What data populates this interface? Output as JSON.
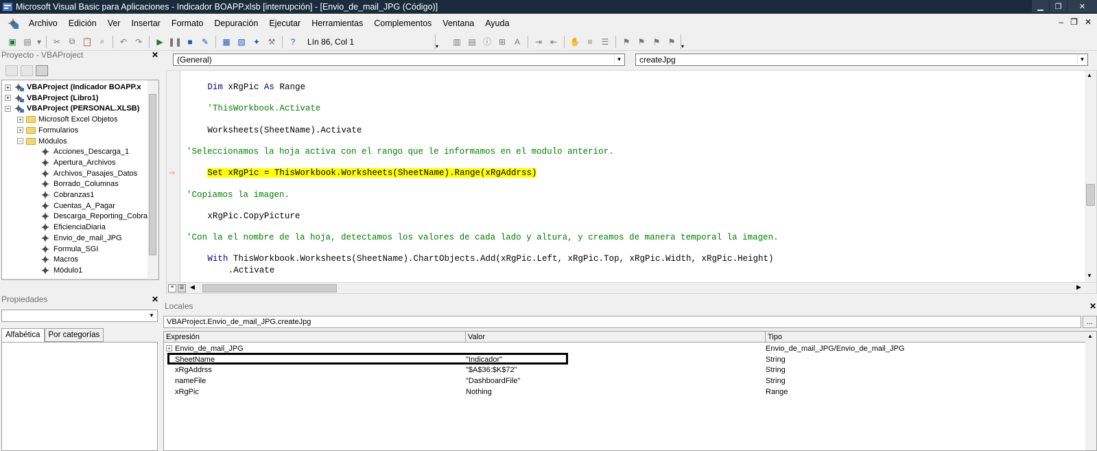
{
  "window": {
    "title": "Microsoft Visual Basic para Aplicaciones - Indicador BOAPP.xlsb [interrupción] - [Envio_de_mail_JPG (Código)]"
  },
  "menu": [
    "Archivo",
    "Edición",
    "Ver",
    "Insertar",
    "Formato",
    "Depuración",
    "Ejecutar",
    "Herramientas",
    "Complementos",
    "Ventana",
    "Ayuda"
  ],
  "toolbar": {
    "position": "Lín 86, Col 1"
  },
  "project": {
    "header": "Proyecto - VBAProject",
    "items": [
      {
        "label": "VBAProject (Indicador BOAPP.x",
        "level": 0,
        "expander": "+",
        "bold": true
      },
      {
        "label": "VBAProject (Libro1)",
        "level": 0,
        "expander": "+",
        "bold": true
      },
      {
        "label": "VBAProject (PERSONAL.XLSB)",
        "level": 0,
        "expander": "−",
        "bold": true
      },
      {
        "label": "Microsoft Excel Objetos",
        "level": 1,
        "expander": "+",
        "folder": true
      },
      {
        "label": "Formularios",
        "level": 1,
        "expander": "+",
        "folder": true
      },
      {
        "label": "Módulos",
        "level": 1,
        "expander": "−",
        "folder": true
      },
      {
        "label": "Acciones_Descarga_1",
        "level": 2
      },
      {
        "label": "Apertura_Archivos",
        "level": 2
      },
      {
        "label": "Archivos_Pasajes_Datos",
        "level": 2
      },
      {
        "label": "Borrado_Columnas",
        "level": 2
      },
      {
        "label": "Cobranzas1",
        "level": 2
      },
      {
        "label": "Cuentas_A_Pagar",
        "level": 2
      },
      {
        "label": "Descarga_Reporting_Cobrar",
        "level": 2
      },
      {
        "label": "EficienciaDiaria",
        "level": 2
      },
      {
        "label": "Envio_de_mail_JPG",
        "level": 2
      },
      {
        "label": "Formula_SGI",
        "level": 2
      },
      {
        "label": "Macros",
        "level": 2
      },
      {
        "label": "Módulo1",
        "level": 2
      }
    ]
  },
  "properties": {
    "header": "Propiedades",
    "tabs": [
      "Alfabética",
      "Por categorías"
    ]
  },
  "code": {
    "object_combo": "(General)",
    "proc_combo": "createJpg",
    "lines": [
      {
        "indent": 4,
        "parts": [
          {
            "t": "Dim ",
            "c": "kw"
          },
          {
            "t": "xRgPic ",
            "c": ""
          },
          {
            "t": "As ",
            "c": "kw"
          },
          {
            "t": "Range",
            "c": ""
          }
        ]
      },
      {
        "indent": 4,
        "parts": [
          {
            "t": "'ThisWorkbook.Activate",
            "c": "cm"
          }
        ]
      },
      {
        "indent": 4,
        "parts": [
          {
            "t": "Worksheets(SheetName).Activate",
            "c": ""
          }
        ]
      },
      {
        "indent": 0,
        "parts": [
          {
            "t": "'Seleccionamos la hoja activa con el rango que le informamos en el modulo anterior.",
            "c": "cm"
          }
        ]
      },
      {
        "indent": 4,
        "current": true,
        "parts": [
          {
            "t": "Set xRgPic = ThisWorkbook.Worksheets(SheetName).Range(xRgAddrss)",
            "c": "hl"
          }
        ]
      },
      {
        "indent": 0,
        "parts": [
          {
            "t": "'Copiamos la imagen.",
            "c": "cm"
          }
        ]
      },
      {
        "indent": 4,
        "parts": [
          {
            "t": "xRgPic.CopyPicture",
            "c": ""
          }
        ]
      },
      {
        "indent": 0,
        "parts": [
          {
            "t": "'Con la el nombre de la hoja, detectamos los valores de cada lado y altura, y creamos de manera temporal la imagen.",
            "c": "cm"
          }
        ]
      },
      {
        "indent": 4,
        "parts": [
          {
            "t": "With ",
            "c": "kw"
          },
          {
            "t": "ThisWorkbook.Worksheets(SheetName).ChartObjects.Add(xRgPic.Left, xRgPic.Top, xRgPic.Width, xRgPic.Height)",
            "c": ""
          }
        ]
      },
      {
        "indent": 8,
        "parts": [
          {
            "t": ".Activate",
            "c": ""
          }
        ]
      }
    ]
  },
  "locals": {
    "header": "Locales",
    "path": "VBAProject.Envio_de_mail_JPG.createJpg",
    "dots": "...",
    "columns": [
      "Expresión",
      "Valor",
      "Tipo"
    ],
    "rows": [
      {
        "expr": "Envio_de_mail_JPG",
        "value": "",
        "type": "Envio_de_mail_JPG/Envio_de_mail_JPG",
        "expander": "+"
      },
      {
        "expr": "SheetName",
        "value": "\"Indicador\"",
        "type": "String"
      },
      {
        "expr": "xRgAddrss",
        "value": "\"$A$36:$K$72\"",
        "type": "String"
      },
      {
        "expr": "nameFile",
        "value": "\"DashboardFile\"",
        "type": "String"
      },
      {
        "expr": "xRgPic",
        "value": "Nothing",
        "type": "Range"
      }
    ]
  }
}
